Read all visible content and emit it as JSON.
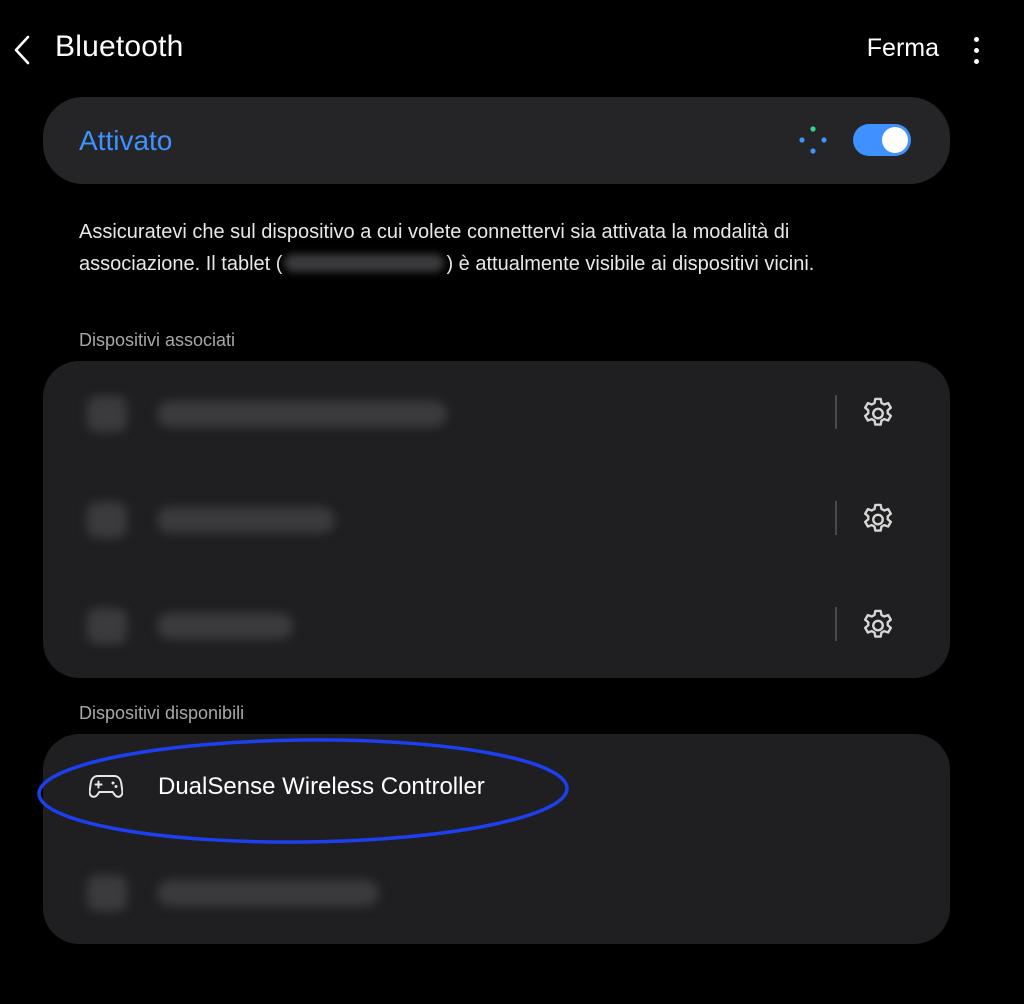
{
  "colors": {
    "accent": "#3e91ff",
    "card_bg": "#1f1f21",
    "toggle_card_bg": "#252527",
    "highlight": "#1c3ff0"
  },
  "header": {
    "title": "Bluetooth",
    "stop_label": "Ferma",
    "back_icon": "chevron-left-icon",
    "more_icon": "more-vertical-icon"
  },
  "bluetooth_toggle": {
    "label": "Attivato",
    "enabled": true
  },
  "description": {
    "text_before": "Assicuratevi che sul dispositivo a cui volete connettervi sia attivata la modalità di associazione. Il tablet (",
    "text_after": ") è attualmente visibile ai dispositivi vicini."
  },
  "paired": {
    "label": "Dispositivi associati",
    "devices": [
      {
        "settings_icon": "gear-icon"
      },
      {
        "settings_icon": "gear-icon"
      },
      {
        "settings_icon": "gear-icon"
      }
    ]
  },
  "available": {
    "label": "Dispositivi disponibili",
    "devices": [
      {
        "name": "DualSense Wireless Controller",
        "icon": "gamepad-icon"
      },
      {
        "name": ""
      }
    ]
  }
}
